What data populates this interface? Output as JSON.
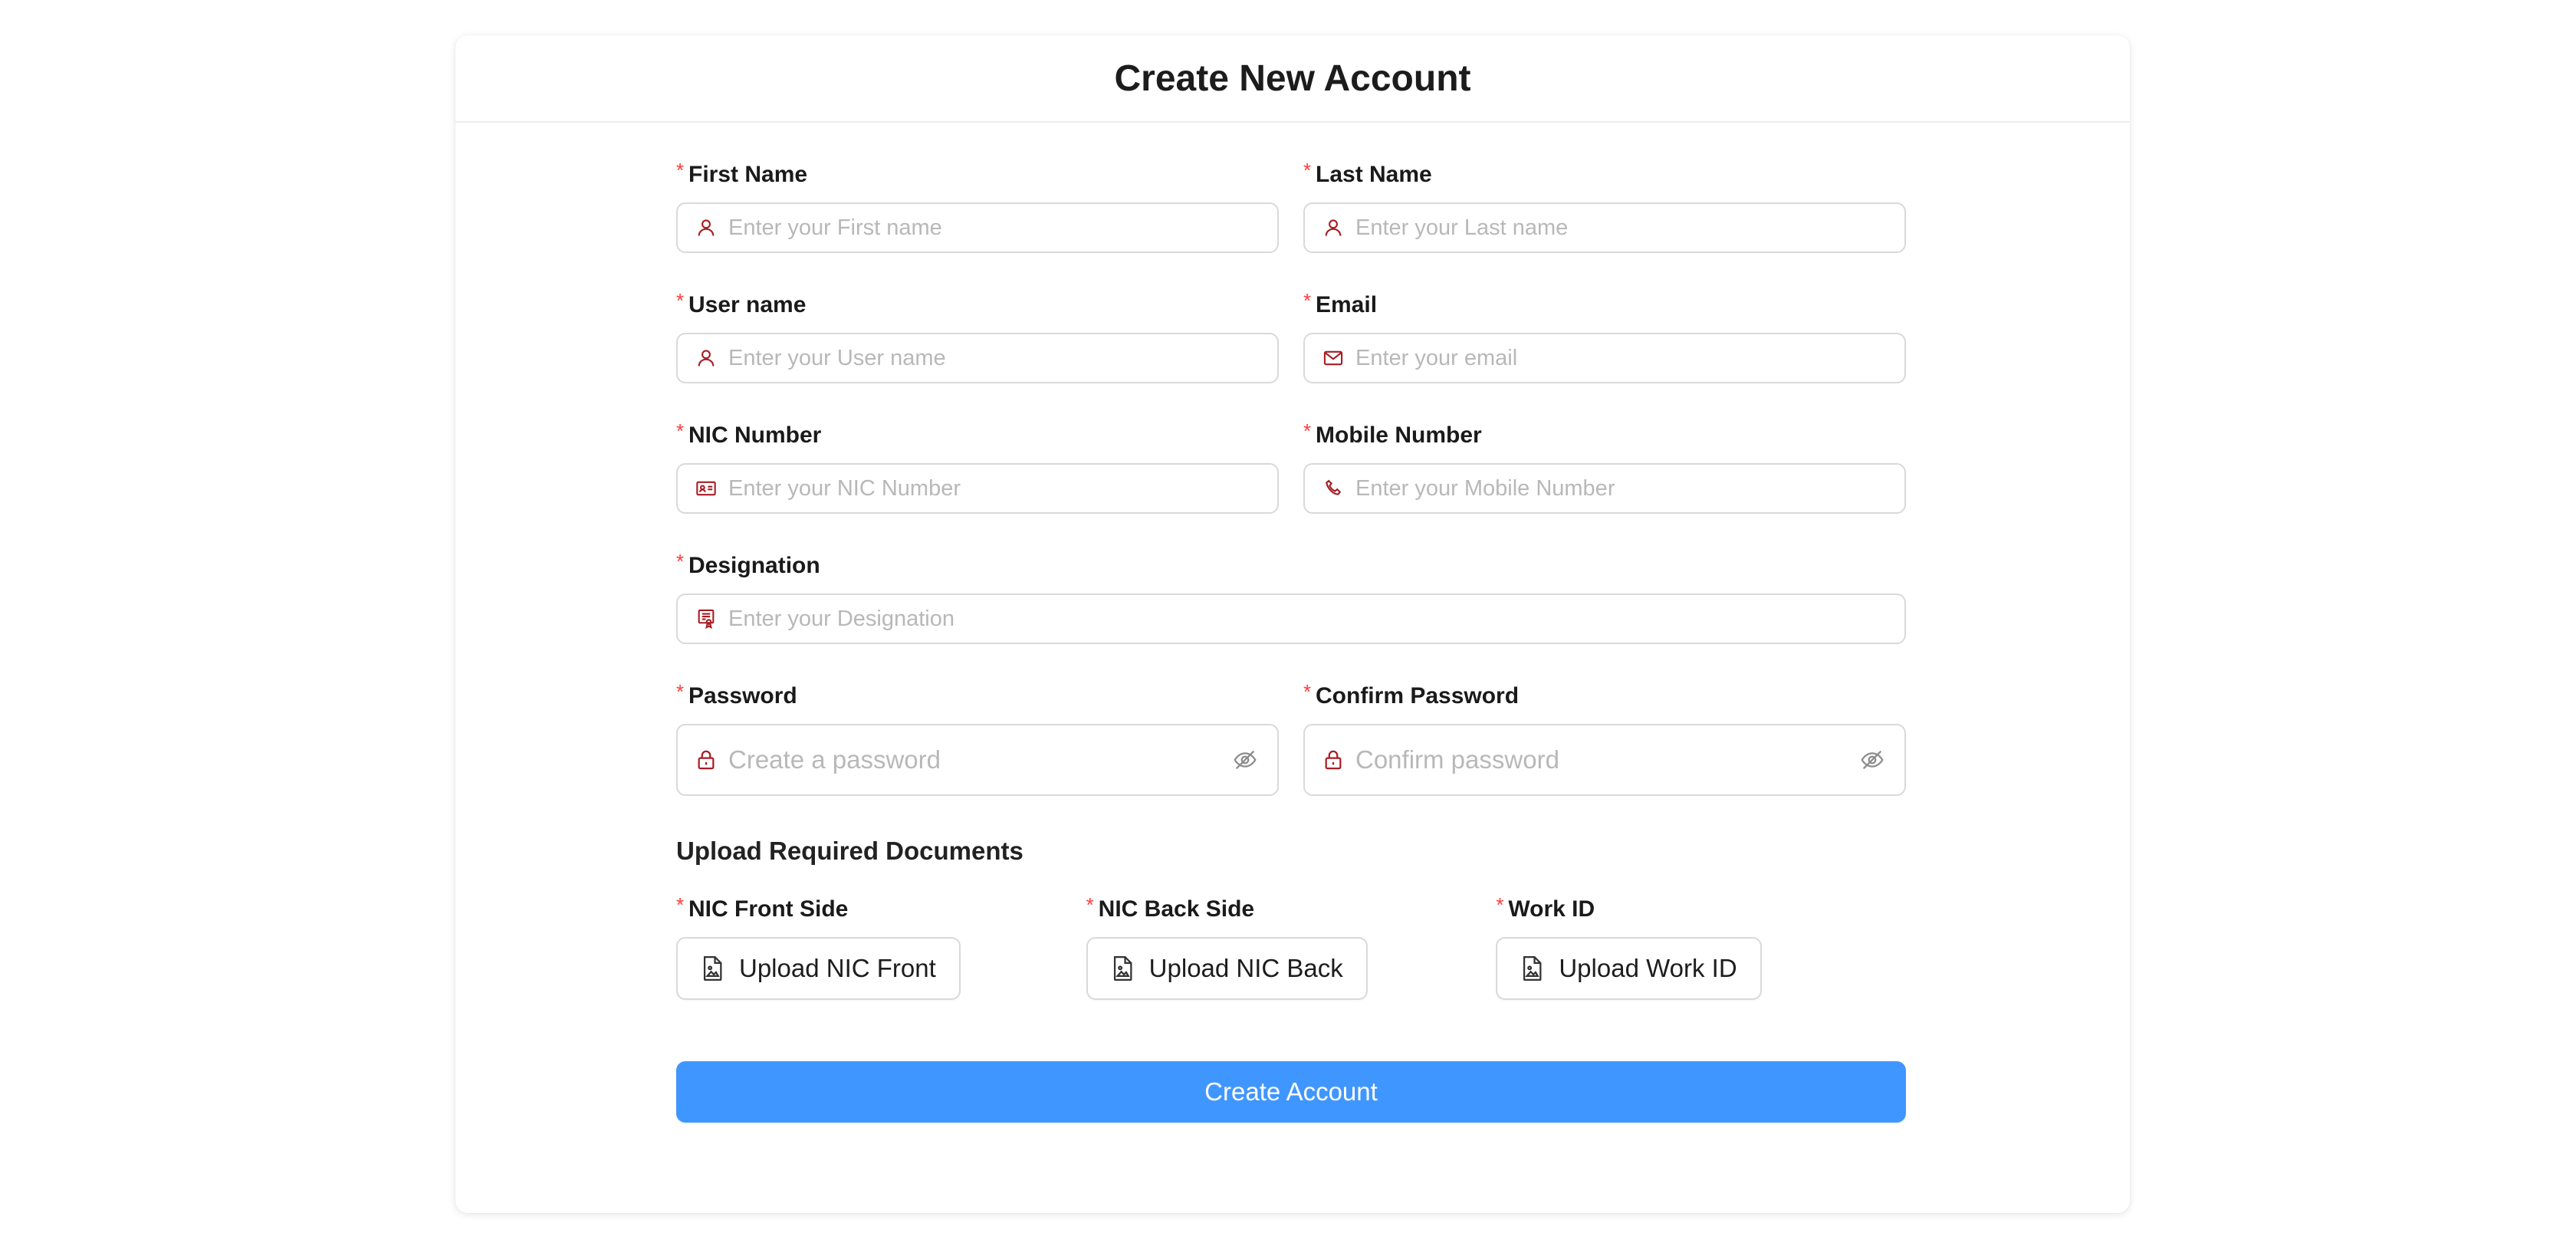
{
  "header": {
    "title": "Create New Account"
  },
  "form": {
    "required_mark": "*",
    "first_name": {
      "label": "First Name",
      "placeholder": "Enter your First name",
      "icon": "user-icon"
    },
    "last_name": {
      "label": "Last Name",
      "placeholder": "Enter your Last name",
      "icon": "user-icon"
    },
    "user_name": {
      "label": "User name",
      "placeholder": "Enter your User name",
      "icon": "user-icon"
    },
    "email": {
      "label": "Email",
      "placeholder": "Enter your email",
      "icon": "mail-icon"
    },
    "nic_number": {
      "label": "NIC Number",
      "placeholder": "Enter your NIC Number",
      "icon": "id-card-icon"
    },
    "mobile_number": {
      "label": "Mobile Number",
      "placeholder": "Enter your Mobile Number",
      "icon": "phone-icon"
    },
    "designation": {
      "label": "Designation",
      "placeholder": "Enter your Designation",
      "icon": "certificate-icon"
    },
    "password": {
      "label": "Password",
      "placeholder": "Create a password",
      "icon": "lock-icon"
    },
    "confirm_password": {
      "label": "Confirm Password",
      "placeholder": "Confirm password",
      "icon": "lock-icon"
    }
  },
  "documents": {
    "title": "Upload Required Documents",
    "items": [
      {
        "label": "NIC Front Side",
        "button": "Upload NIC Front"
      },
      {
        "label": "NIC Back Side",
        "button": "Upload NIC Back"
      },
      {
        "label": "Work ID",
        "button": "Upload Work ID"
      }
    ]
  },
  "submit": {
    "label": "Create Account"
  },
  "colors": {
    "accent": "#4096ff",
    "icon": "#a61d24",
    "required": "#ff3b3b",
    "border": "#d9d9d9"
  }
}
